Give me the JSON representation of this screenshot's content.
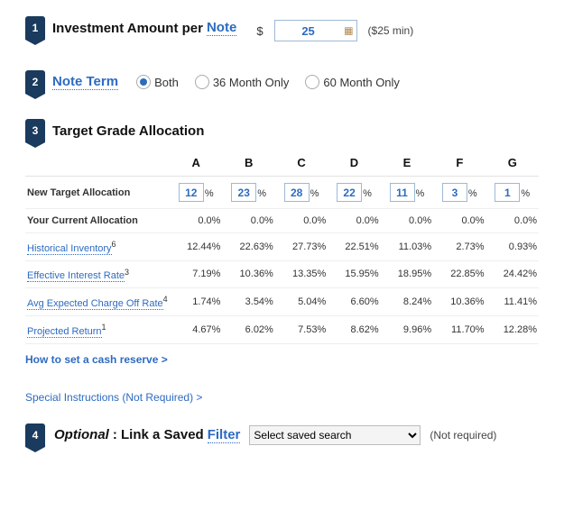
{
  "step1": {
    "number": "1",
    "title_prefix": "Investment Amount per ",
    "title_link": "Note",
    "currency": "$",
    "amount_value": "25",
    "min_hint": "($25 min)"
  },
  "step2": {
    "number": "2",
    "title_link": "Note Term",
    "options": [
      {
        "label": "Both",
        "checked": true
      },
      {
        "label": "36 Month Only",
        "checked": false
      },
      {
        "label": "60 Month Only",
        "checked": false
      }
    ]
  },
  "step3": {
    "number": "3",
    "title": "Target Grade Allocation",
    "grades": [
      "A",
      "B",
      "C",
      "D",
      "E",
      "F",
      "G"
    ],
    "new_target_label": "New Target Allocation",
    "new_target_values": [
      "12",
      "23",
      "28",
      "22",
      "11",
      "3",
      "1"
    ],
    "current_label": "Your Current Allocation",
    "current_values": [
      "0.0%",
      "0.0%",
      "0.0%",
      "0.0%",
      "0.0%",
      "0.0%",
      "0.0%"
    ],
    "rows": [
      {
        "label": "Historical Inventory",
        "sup": "6",
        "values": [
          "12.44%",
          "22.63%",
          "27.73%",
          "22.51%",
          "11.03%",
          "2.73%",
          "0.93%"
        ]
      },
      {
        "label": "Effective Interest Rate",
        "sup": "3",
        "values": [
          "7.19%",
          "10.36%",
          "13.35%",
          "15.95%",
          "18.95%",
          "22.85%",
          "24.42%"
        ]
      },
      {
        "label": "Avg Expected Charge Off Rate",
        "sup": "4",
        "values": [
          "1.74%",
          "3.54%",
          "5.04%",
          "6.60%",
          "8.24%",
          "10.36%",
          "11.41%"
        ]
      },
      {
        "label": "Projected Return",
        "sup": "1",
        "values": [
          "4.67%",
          "6.02%",
          "7.53%",
          "8.62%",
          "9.96%",
          "11.70%",
          "12.28%"
        ]
      }
    ],
    "cash_reserve_link": "How to set a cash reserve >"
  },
  "special_link": "Special Instructions (Not Required) >",
  "step4": {
    "number": "4",
    "title_prefix_italic": "Optional",
    "title_mid": ": Link a Saved ",
    "title_link": "Filter",
    "select_placeholder": "Select saved search",
    "not_required": "(Not required)"
  }
}
